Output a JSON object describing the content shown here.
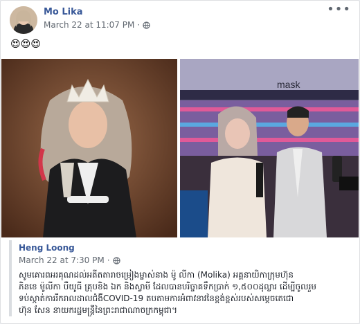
{
  "post": {
    "author": "Mo Lika",
    "timestamp": "March 22 at 11:07 PM",
    "separator": "·",
    "privacy_icon": "globe-icon",
    "more_icon": "more-options-icon",
    "more_glyph": "•••",
    "emoji_text": "😍😍😍"
  },
  "shared_post": {
    "author": "Heng Loong",
    "timestamp": "March 22 at 7:30 PM",
    "separator": "·",
    "privacy_icon": "globe-icon",
    "text_lines": [
      "សូមគោរពអរគុណដល់អតីតតារាចម្រៀងម្ចាស់នាង ម៉ូ លីកា (Molika) អគ្គនាយិកាក្រុមហ៊ុន",
      "ភិនខេ ម៉ូលីកា បឺយូធី គ្រុបខិង ឯក និងស្វាមី ដែលបានបរិច្ចាគទឹកប្រាក់ ១,៥០០ដុល្លារ ដើម្បីចូលរួម",
      "ទប់ស្កាត់ការរីករាលដាលជំងឺCOVID-19 តបតាមការអំពាវនាវនៃខ្ពង់ខ្ពស់របស់សម្តេចតេជោ",
      "ហ៊ុន សែន នាយករដ្ឋមន្ត្រីនៃព្រះរាជាណាចក្រកម្ពុជា។"
    ]
  },
  "photos": {
    "left_sign": "",
    "right_sign": "mask"
  },
  "colors": {
    "link": "#385898",
    "meta": "#606770",
    "border": "#dddfe2"
  }
}
